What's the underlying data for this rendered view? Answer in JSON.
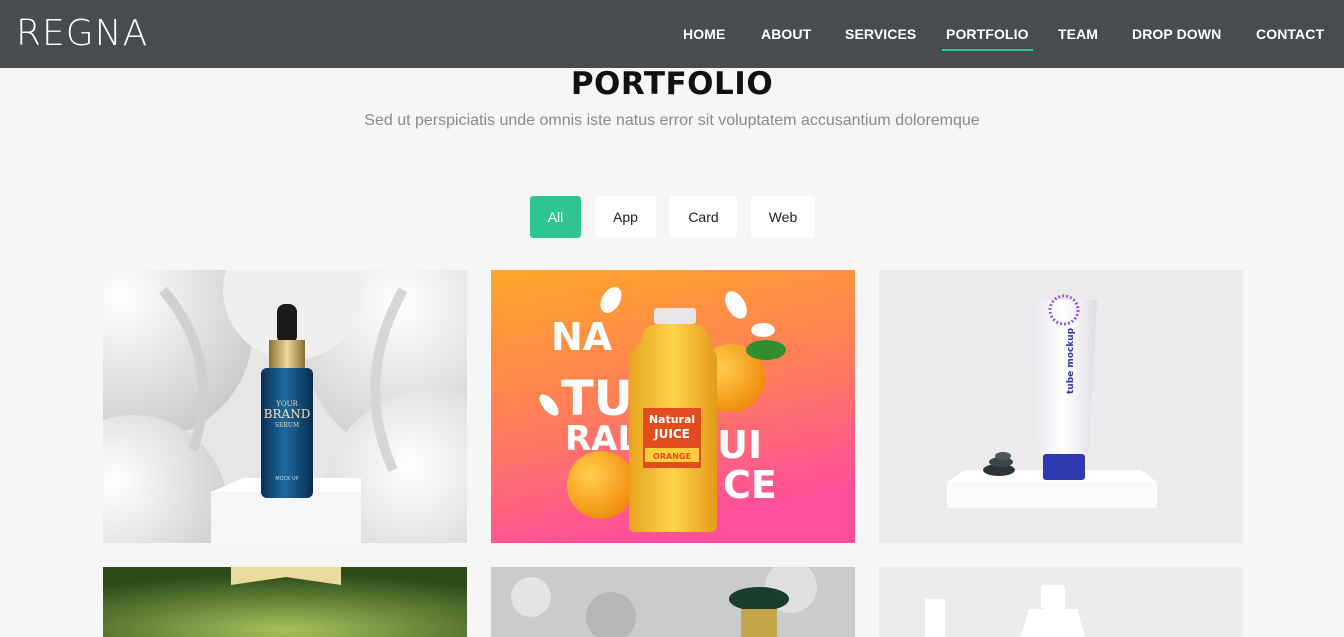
{
  "header": {
    "logo": "REGNA",
    "nav": [
      "HOME",
      "ABOUT",
      "SERVICES",
      "PORTFOLIO",
      "TEAM",
      "DROP DOWN",
      "CONTACT"
    ],
    "active": "PORTFOLIO"
  },
  "section": {
    "title": "PORTFOLIO",
    "subtitle": "Sed ut perspiciatis unde omnis iste natus error sit voluptatem accusantium doloremque"
  },
  "filters": {
    "items": [
      "All",
      "App",
      "Card",
      "Web"
    ],
    "active": "All"
  },
  "portfolio": {
    "serum": {
      "brand_top": "YOUR",
      "brand": "BRAND",
      "brand_sub": "SERUM",
      "mockup": "MOCK UP"
    },
    "juice": {
      "words": [
        "NA",
        "TU",
        "RAL",
        "JUI",
        "CE"
      ],
      "label_top": "Natural",
      "label_main": "JUICE",
      "label_flavor": "ORANGE"
    },
    "tube": {
      "label": "tube mockup"
    }
  },
  "colors": {
    "header_bg": "#474c4f",
    "accent": "#2fc493",
    "page_bg": "#f6f6f6"
  }
}
